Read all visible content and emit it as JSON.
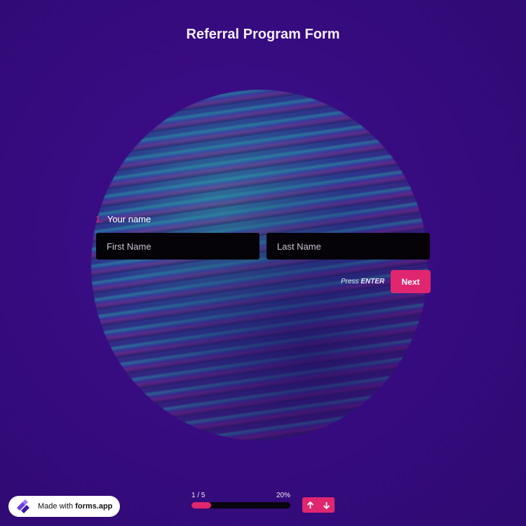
{
  "form": {
    "title": "Referral Program Form"
  },
  "question": {
    "number": "1.",
    "label": "Your name",
    "first_name_placeholder": "First Name",
    "last_name_placeholder": "Last Name",
    "first_name_value": "",
    "last_name_value": ""
  },
  "actions": {
    "hint_prefix": "Press",
    "hint_key": "ENTER",
    "next_label": "Next"
  },
  "progress": {
    "current_label": "1 / 5",
    "percent_label": "20%",
    "fraction": 0.2
  },
  "footer": {
    "badge_prefix": "Made with",
    "badge_brand": "forms.app"
  },
  "icons": {
    "nav_up": "arrow-up-icon",
    "nav_down": "arrow-down-icon",
    "logo": "forms-app-logo-icon"
  },
  "colors": {
    "accent": "#e0266f",
    "background": "#3a0d84",
    "input_bg": "#050307"
  }
}
